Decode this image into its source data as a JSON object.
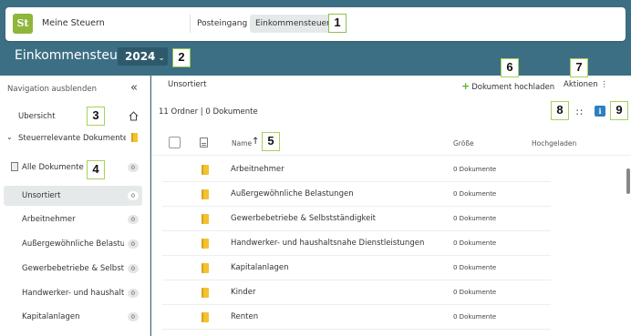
{
  "topbar": {
    "app_name": "Meine Steuern",
    "logo_text": "St",
    "tabs": [
      {
        "label": "Posteingang",
        "active": false
      },
      {
        "label": "Einkommensteuer",
        "active": true
      }
    ]
  },
  "header": {
    "title": "Einkommensteuer",
    "year": "2024",
    "year_chevron": "⌄",
    "background_color": "#3d6f84"
  },
  "callouts": [
    "1",
    "2",
    "3",
    "4",
    "5",
    "6",
    "7",
    "8",
    "9"
  ],
  "sidebar": {
    "hide_label": "Navigation ausblenden",
    "collapse_glyph": "«",
    "overview_label": "Übersicht",
    "relevant_label": "Steuerrelevante Dokumente",
    "all_docs_label": "Alle Dokumente",
    "all_docs_count": "0",
    "items": [
      {
        "label": "Unsortiert",
        "count": "0",
        "active": true
      },
      {
        "label": "Arbeitnehmer",
        "count": "0",
        "active": false
      },
      {
        "label": "Außergewöhnliche Belastu...",
        "count": "0",
        "active": false
      },
      {
        "label": "Gewerbebetriebe & Selbsts...",
        "count": "0",
        "active": false
      },
      {
        "label": "Handwerker- und haushalt...",
        "count": "0",
        "active": false
      },
      {
        "label": "Kapitalanlagen",
        "count": "0",
        "active": false
      }
    ]
  },
  "main": {
    "breadcrumb": "Unsortiert",
    "upload_label": "Dokument hochladen",
    "actions_label": "Aktionen ⋮",
    "count_text": "11 Ordner | 0 Dokumente",
    "grid_glyph": "∷",
    "info_glyph": "i",
    "columns": {
      "name": "Name",
      "sort_arrow": "↑",
      "size": "Größe",
      "uploaded": "Hochgeladen"
    },
    "rows": [
      {
        "name": "Arbeitnehmer",
        "size": "0 Dokumente"
      },
      {
        "name": "Außergewöhnliche Belastungen",
        "size": "0 Dokumente"
      },
      {
        "name": "Gewerbebetriebe & Selbstständigkeit",
        "size": "0 Dokumente"
      },
      {
        "name": "Handwerker- und haushaltsnahe Dienstleistungen",
        "size": "0 Dokumente"
      },
      {
        "name": "Kapitalanlagen",
        "size": "0 Dokumente"
      },
      {
        "name": "Kinder",
        "size": "0 Dokumente"
      },
      {
        "name": "Renten",
        "size": "0 Dokumente"
      }
    ]
  },
  "colors": {
    "accent_green": "#5cb335",
    "folder": "#f2c231",
    "info_blue": "#2e7fbf",
    "callout_border": "#8bc34a"
  }
}
